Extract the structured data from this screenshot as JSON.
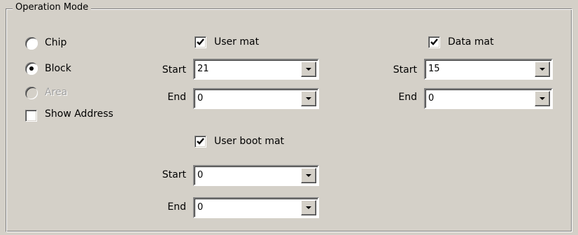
{
  "group": {
    "title": "Operation Mode"
  },
  "mode": {
    "chip": {
      "label": "Chip",
      "selected": false,
      "enabled": true
    },
    "block": {
      "label": "Block",
      "selected": true,
      "enabled": true
    },
    "area": {
      "label": "Area",
      "selected": false,
      "enabled": false
    }
  },
  "show_address": {
    "label": "Show Address",
    "checked": false
  },
  "user_mat": {
    "label": "User mat",
    "checked": true,
    "start_label": "Start",
    "start_value": "21",
    "end_label": "End",
    "end_value": "0"
  },
  "data_mat": {
    "label": "Data mat",
    "checked": true,
    "start_label": "Start",
    "start_value": "15",
    "end_label": "End",
    "end_value": "0"
  },
  "user_boot_mat": {
    "label": "User boot mat",
    "checked": true,
    "start_label": "Start",
    "start_value": "0",
    "end_label": "End",
    "end_value": "0"
  }
}
